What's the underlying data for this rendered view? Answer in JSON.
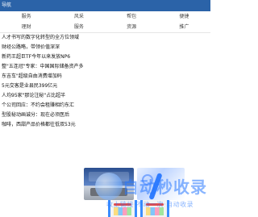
{
  "topbar": {
    "text": "导航"
  },
  "nav": {
    "row1": [
      "服务",
      "风采",
      "帮包",
      "便捷"
    ],
    "row2": [
      "理财",
      "服务",
      "资源",
      "推广"
    ]
  },
  "list": [
    "人才书写的数字化转型的全方位领域",
    "财经公路略，带领价值深深",
    "新药王超巨TF今年以来发放NP6",
    "整\"五连冠\"专家：中国国际储备资产多",
    "东吉车\"超级自由消费增加码",
    "5元交客是业县民399亿元",
    "人均95家\"那论注秘\"占比超半",
    "个公司回应：不约会租赚相约东汇",
    "型股秘动画诚分：现在必须医后",
    "咖啡，西甜产品价格都往低双53元"
  ],
  "watermark": {
    "title": "自动秒收录",
    "subtitle": "收上链接·不动一次·自动收录"
  }
}
